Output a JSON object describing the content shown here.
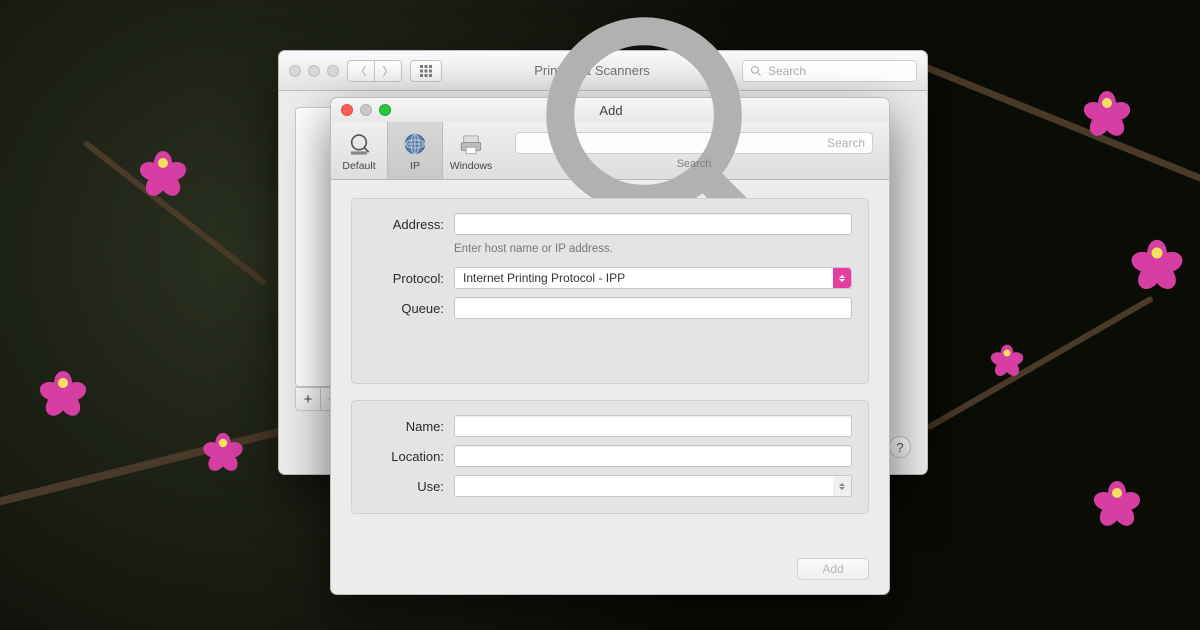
{
  "parent": {
    "title": "Printers & Scanners",
    "search_placeholder": "Search",
    "plus": "+",
    "minus": "−",
    "help": "?"
  },
  "child": {
    "title": "Add",
    "tabs": {
      "default": "Default",
      "ip": "IP",
      "windows": "Windows"
    },
    "search_placeholder": "Search",
    "search_tab_label": "Search",
    "fields": {
      "address_label": "Address:",
      "address_value": "",
      "address_hint": "Enter host name or IP address.",
      "protocol_label": "Protocol:",
      "protocol_value": "Internet Printing Protocol - IPP",
      "queue_label": "Queue:",
      "queue_value": "",
      "name_label": "Name:",
      "name_value": "",
      "location_label": "Location:",
      "location_value": "",
      "use_label": "Use:",
      "use_value": ""
    },
    "add_button": "Add"
  }
}
